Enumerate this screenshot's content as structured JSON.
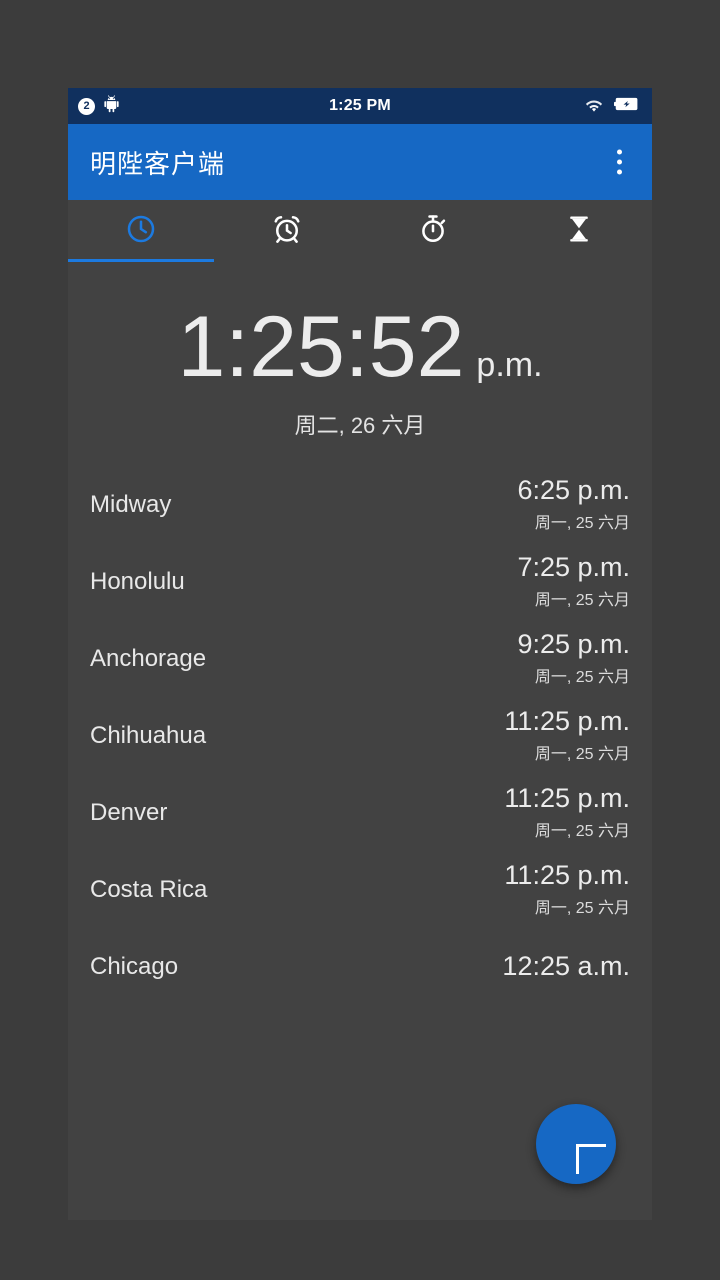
{
  "status_bar": {
    "notification_count": "2",
    "android_icon": "android-robot-icon",
    "time": "1:25 PM",
    "wifi_icon": "wifi-icon",
    "battery_icon": "battery-charging-icon",
    "background_color": "#10305e"
  },
  "app_bar": {
    "title": "明陛客户端",
    "overflow_icon": "more-vertical-icon",
    "background_color": "#1668c4"
  },
  "tabs": [
    {
      "name": "clock",
      "icon": "clock-icon",
      "active": true
    },
    {
      "name": "alarm",
      "icon": "alarm-icon",
      "active": false
    },
    {
      "name": "stopwatch",
      "icon": "stopwatch-icon",
      "active": false
    },
    {
      "name": "timer",
      "icon": "hourglass-icon",
      "active": false
    }
  ],
  "tab_accent_color": "#1c7ae0",
  "main_clock": {
    "time": "1:25:52",
    "meridiem": "p.m.",
    "date": "周二, 26 六月"
  },
  "cities": [
    {
      "name": "Midway",
      "time": "6:25 p.m.",
      "date": "周一, 25 六月"
    },
    {
      "name": "Honolulu",
      "time": "7:25 p.m.",
      "date": "周一, 25 六月"
    },
    {
      "name": "Anchorage",
      "time": "9:25 p.m.",
      "date": "周一, 25 六月"
    },
    {
      "name": "Chihuahua",
      "time": "11:25 p.m.",
      "date": "周一, 25 六月"
    },
    {
      "name": "Denver",
      "time": "11:25 p.m.",
      "date": "周一, 25 六月"
    },
    {
      "name": "Costa Rica",
      "time": "11:25 p.m.",
      "date": "周一, 25 六月"
    },
    {
      "name": "Chicago",
      "time": "12:25 a.m.",
      "date": ""
    }
  ],
  "fab": {
    "icon": "plus-icon",
    "color": "#1668c4"
  },
  "background_color": "#424242"
}
